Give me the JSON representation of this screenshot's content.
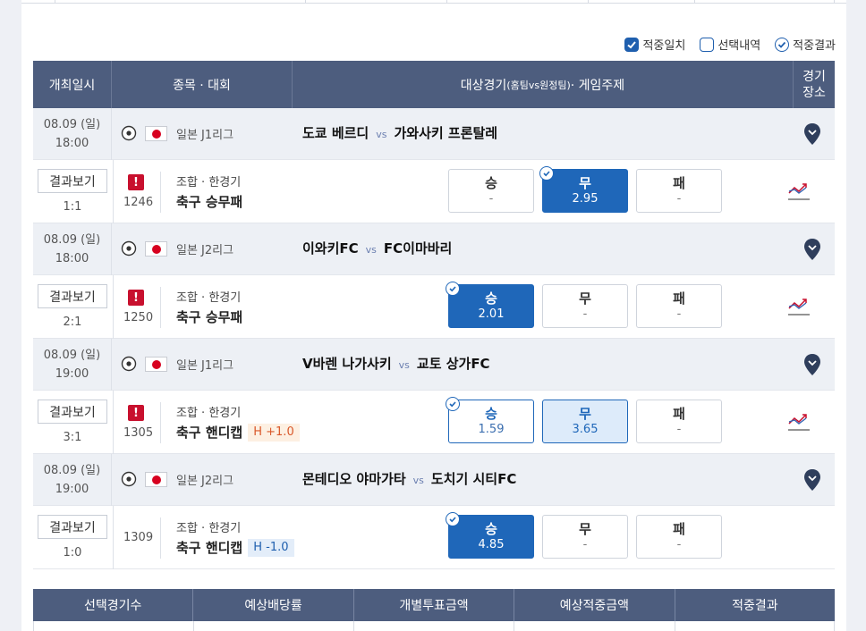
{
  "legend": {
    "match_hit": "적중일치",
    "selection": "선택내역",
    "result": "적중결과"
  },
  "header": {
    "date": "개최일시",
    "sport_league": "종목 · 대회",
    "target": "대상경기",
    "target_small": "(홈팀vs원정팀)",
    "target_suffix": " · 게임주제",
    "venue_line1": "경기",
    "venue_line2": "장소"
  },
  "vs_label": "vs",
  "result_button": "결과보기",
  "combo_label": "조합 · 한경기",
  "colors": {
    "header_bg": "#4d5d7e",
    "accent": "#1f67b9",
    "warn": "#c8102e"
  },
  "games": [
    {
      "date": "08.09 (일)",
      "time": "18:00",
      "league": "일본 J1리그",
      "home": "도쿄 베르디",
      "away": "가와사키 프론탈레",
      "score": "1:1",
      "number": "1246",
      "warning": "!",
      "type": "축구 승무패",
      "handicap": "",
      "odds": [
        {
          "label": "승",
          "value": "-"
        },
        {
          "label": "무",
          "value": "2.95"
        },
        {
          "label": "패",
          "value": "-"
        }
      ]
    },
    {
      "date": "08.09 (일)",
      "time": "18:00",
      "league": "일본 J2리그",
      "home": "이와키FC",
      "away": "FC이마바리",
      "score": "2:1",
      "number": "1250",
      "warning": "!",
      "type": "축구 승무패",
      "handicap": "",
      "odds": [
        {
          "label": "승",
          "value": "2.01"
        },
        {
          "label": "무",
          "value": "-"
        },
        {
          "label": "패",
          "value": "-"
        }
      ]
    },
    {
      "date": "08.09 (일)",
      "time": "19:00",
      "league": "일본 J1리그",
      "home": "V바렌 나가사키",
      "away": "교토 상가FC",
      "score": "3:1",
      "number": "1305",
      "warning": "!",
      "type": "축구 핸디캡",
      "handicap": "H +1.0",
      "odds": [
        {
          "label": "승",
          "value": "1.59"
        },
        {
          "label": "무",
          "value": "3.65"
        },
        {
          "label": "패",
          "value": "-"
        }
      ]
    },
    {
      "date": "08.09 (일)",
      "time": "19:00",
      "league": "일본 J2리그",
      "home": "몬테디오 야마가타",
      "away": "도치기 시티FC",
      "score": "1:0",
      "number": "1309",
      "warning": "",
      "type": "축구 핸디캡",
      "handicap": "H -1.0",
      "odds": [
        {
          "label": "승",
          "value": "4.85"
        },
        {
          "label": "무",
          "value": "-"
        },
        {
          "label": "패",
          "value": "-"
        }
      ]
    }
  ],
  "footer": {
    "col1": "선택경기수",
    "col2": "예상배당률",
    "col3": "개별투표금액",
    "col4": "예상적중금액",
    "col5": "적중결과"
  }
}
